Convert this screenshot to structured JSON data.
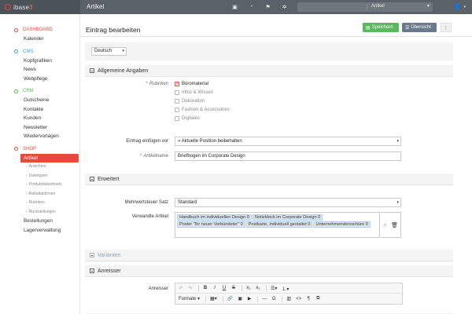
{
  "app": {
    "brand_prefix": "ibase",
    "brand_suffix": "3",
    "title": "Artikel"
  },
  "topbar": {
    "icons": [
      "image-icon",
      "chart-icon",
      "bookmark-icon",
      "settings-icon"
    ],
    "search_placeholder": "",
    "search_scope": "Artikel",
    "user_icon": "user-icon"
  },
  "sidebar": {
    "sections": [
      {
        "head": "DASHBOARD",
        "color": "#e64a3b",
        "items": [
          "Kalender"
        ]
      },
      {
        "head": "CMS",
        "color": "#2fa4e7",
        "items": [
          "Kopfgrafiken",
          "News",
          "Webpflege"
        ]
      },
      {
        "head": "CRM",
        "color": "#5cb85c",
        "items": [
          "Gutscheine",
          "Kontakte",
          "Kunden",
          "Newsletter",
          "Wiedervorlagen"
        ]
      },
      {
        "head": "SHOP",
        "color": "#e64a3b",
        "active": "Artikel",
        "subitems": [
          "Ansichten",
          "Dateitypen",
          "Produktdatenfeeds",
          "Rabattaktionen",
          "Rubriken",
          "Rückstellungen"
        ],
        "items_after": [
          "Bestellungen",
          "Lagerverwaltung"
        ]
      }
    ]
  },
  "main": {
    "page_title": "Eintrag bearbeiten",
    "save_label": "Speichern",
    "overview_label": "Übersicht",
    "more_label": "⋮",
    "language": "Deutsch",
    "sec_general": "Allgemeine Angaben",
    "rubriken_label": "Rubriken",
    "rubriken": [
      {
        "label": "Büromaterial",
        "checked": true
      },
      {
        "label": "Infos & Wissen",
        "checked": false
      },
      {
        "label": "Dekoration",
        "checked": false
      },
      {
        "label": "Fashion & Accessoires",
        "checked": false
      },
      {
        "label": "Digitales",
        "checked": false
      }
    ],
    "insert_label": "Eintrag einfügen vor",
    "insert_value": "» Aktuelle Position beibehalten",
    "name_label": "Artikelname",
    "name_value": "Briefbogen im Corporate Design",
    "sec_extended": "Erweitert",
    "vat_label": "Mehrwertsteuer Satz",
    "vat_value": "Standard",
    "related_label": "Verwandte Artikel",
    "related": [
      "Handbuch im individuellen Design 0",
      "Notizblock im Corporate Design 0",
      "Poster \"Ihr neuer Verbündeter\" 0",
      "Postkarte, individuell gestaltet 0",
      "Unternehmensbroschüre 0"
    ],
    "sec_variants": "Varianten",
    "sec_teaser": "Anreisser",
    "teaser_label": "Anreisser",
    "format_label": "Formate"
  }
}
